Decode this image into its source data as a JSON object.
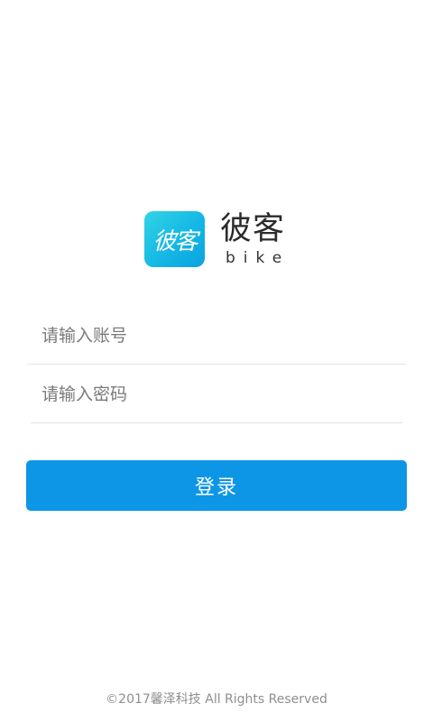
{
  "logo": {
    "icon_text": "彼客",
    "brand_name": "彼客",
    "brand_subtitle": "bike",
    "icon_gradient": [
      "#34d3e6",
      "#0aa2e0"
    ]
  },
  "form": {
    "account_placeholder": "请输入账号",
    "password_placeholder": "请输入密码",
    "login_label": "登录"
  },
  "footer": {
    "copyright": "©2017馨泽科技 All Rights Reserved"
  },
  "colors": {
    "primary": "#0d96e6",
    "divider": "#e3e3e3",
    "background": "#ffffff"
  }
}
